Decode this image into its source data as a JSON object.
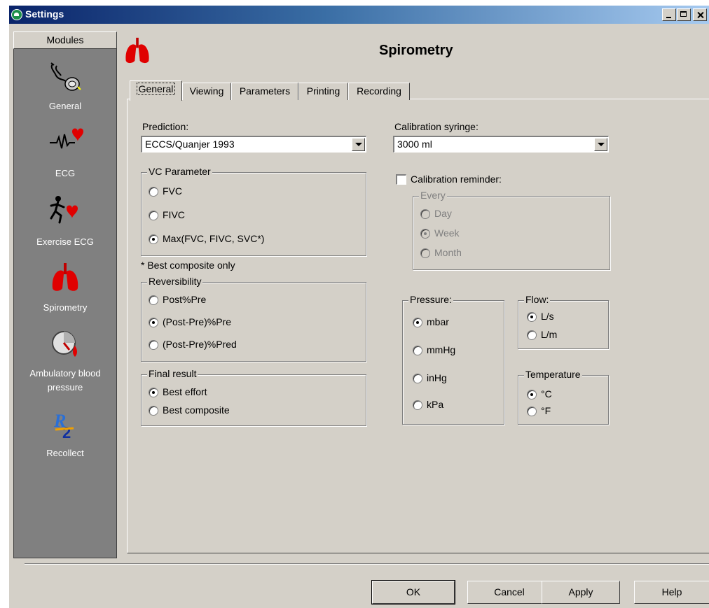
{
  "window": {
    "title": "Settings"
  },
  "modules": {
    "header": "Modules",
    "items": [
      {
        "label": "General",
        "icon": "stethoscope-icon"
      },
      {
        "label": "ECG",
        "icon": "heart-ecg-icon"
      },
      {
        "label": "Exercise ECG",
        "icon": "runner-heart-icon"
      },
      {
        "label": "Spirometry",
        "icon": "lungs-icon"
      },
      {
        "label": "Ambulatory blood pressure",
        "icon": "blood-pressure-icon"
      },
      {
        "label": "Recollect",
        "icon": "recollect-logo-icon"
      }
    ]
  },
  "page": {
    "title": "Spirometry"
  },
  "tabs": [
    "General",
    "Viewing",
    "Parameters",
    "Printing",
    "Recording"
  ],
  "general": {
    "prediction": {
      "label": "Prediction:",
      "value": "ECCS/Quanjer 1993"
    },
    "vc_parameter": {
      "title": "VC Parameter",
      "options": [
        "FVC",
        "FIVC",
        "Max(FVC, FIVC, SVC*)"
      ],
      "selected": 2
    },
    "footnote": "* Best composite only",
    "reversibility": {
      "title": "Reversibility",
      "options": [
        "Post%Pre",
        "(Post-Pre)%Pre",
        "(Post-Pre)%Pred"
      ],
      "selected": 1
    },
    "final_result": {
      "title": "Final result",
      "options": [
        "Best effort",
        "Best composite"
      ],
      "selected": 0
    },
    "calibration_syringe": {
      "label": "Calibration syringe:",
      "value": "3000 ml"
    },
    "calibration_reminder": {
      "label": "Calibration reminder:",
      "checked": false
    },
    "every": {
      "title": "Every",
      "options": [
        "Day",
        "Week",
        "Month"
      ],
      "selected": 1,
      "enabled": false
    },
    "pressure": {
      "title": "Pressure:",
      "options": [
        "mbar",
        "mmHg",
        "inHg",
        "kPa"
      ],
      "selected": 0
    },
    "flow": {
      "title": "Flow:",
      "options": [
        "L/s",
        "L/m"
      ],
      "selected": 0
    },
    "temperature": {
      "title": "Temperature",
      "options": [
        "°C",
        "°F"
      ],
      "selected": 0
    }
  },
  "buttons": {
    "ok": "OK",
    "cancel": "Cancel",
    "apply": "Apply",
    "help": "Help"
  }
}
